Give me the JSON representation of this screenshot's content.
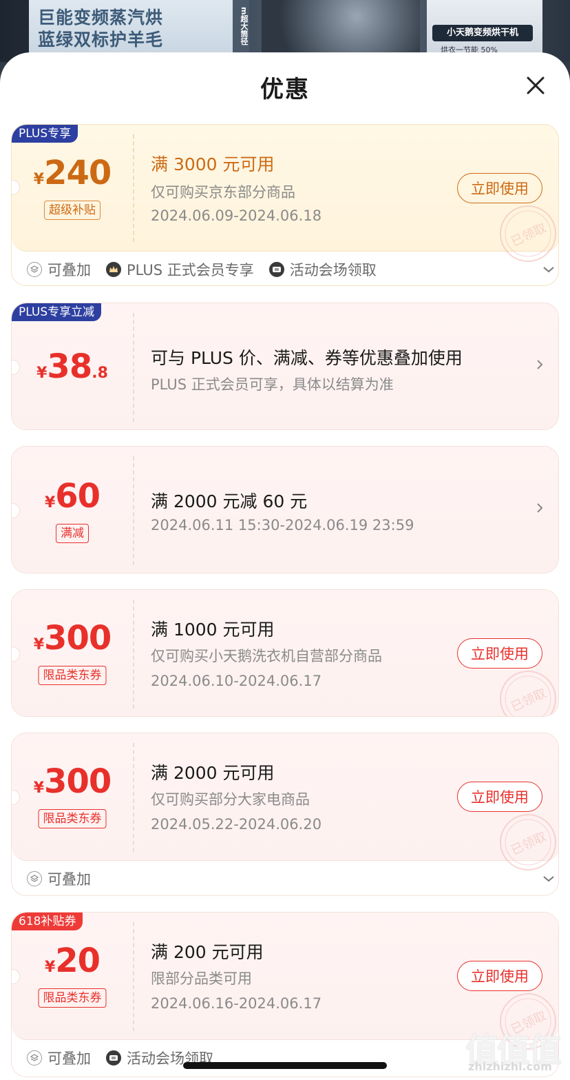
{
  "banner": {
    "line1": "巨能变频蒸汽烘",
    "line2": "蓝绿双标护羊毛",
    "vertical_tag": "m超大筒径",
    "right_badge": "小天鹅变频烘干机",
    "right_sub": "烘衣一节能 50%"
  },
  "sheet": {
    "title": "优惠",
    "close_icon": "close-icon"
  },
  "cards": [
    {
      "tag": "PLUS专享",
      "currency": "¥",
      "amount": "240",
      "pill": "超级补贴",
      "line1": "满 3000 元可用",
      "line2": "仅可购买京东部分商品",
      "line3": "2024.06.09-2024.06.18",
      "button": "立即使用",
      "stamp": "已领取",
      "footer": [
        "可叠加",
        "PLUS 正式会员专享",
        "活动会场领取"
      ]
    },
    {
      "tag": "PLUS专享立减",
      "currency": "¥",
      "amount": "38",
      "decimal": ".8",
      "line1": "可与 PLUS 价、满减、券等优惠叠加使用",
      "line2": "PLUS 正式会员可享，具体以结算为准"
    },
    {
      "currency": "¥",
      "amount": "60",
      "pill": "满减",
      "line1": "满 2000 元减 60 元",
      "line2": "2024.06.11 15:30-2024.06.19 23:59"
    },
    {
      "currency": "¥",
      "amount": "300",
      "pill": "限品类东券",
      "line1": "满 1000 元可用",
      "line2": "仅可购买小天鹅洗衣机自营部分商品",
      "line3": "2024.06.10-2024.06.17",
      "button": "立即使用",
      "stamp": "已领取"
    },
    {
      "currency": "¥",
      "amount": "300",
      "pill": "限品类东券",
      "line1": "满 2000 元可用",
      "line2": "仅可购买部分大家电商品",
      "line3": "2024.05.22-2024.06.20",
      "button": "立即使用",
      "stamp": "已领取",
      "footer": [
        "可叠加"
      ]
    },
    {
      "tag": "618补贴券",
      "currency": "¥",
      "amount": "20",
      "pill": "限品类东券",
      "line1": "满 200 元可用",
      "line2": "限部分品类可用",
      "line3": "2024.06.16-2024.06.17",
      "button": "立即使用",
      "stamp": "已领取",
      "footer": [
        "可叠加",
        "活动会场领取"
      ]
    }
  ],
  "watermark": {
    "text": "值值值",
    "site": "zhizhizhi.com"
  },
  "colors": {
    "accent_red": "#e8302b",
    "accent_orange": "#cc6a14",
    "plus_blue": "#2d3fa0"
  }
}
